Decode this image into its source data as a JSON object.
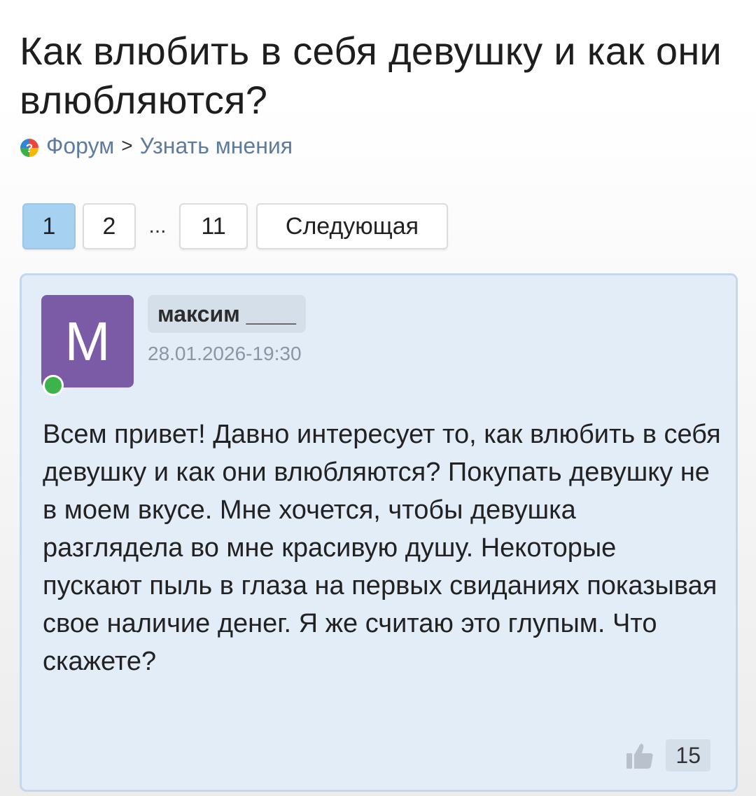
{
  "topic": {
    "title": "Как влюбить в себя девушку и как они влюбляются?"
  },
  "breadcrumb": {
    "icon": "forum-question-icon",
    "forum": "Форум",
    "separator": ">",
    "section": "Узнать мнения"
  },
  "pagination": {
    "pages": [
      "1",
      "2",
      "11"
    ],
    "current": "1",
    "ellipsis": "...",
    "next_label": "Следующая"
  },
  "post": {
    "avatar_letter": "М",
    "avatar_color": "#7b5aa6",
    "online": true,
    "online_color": "#3cb44b",
    "author": "максим ____",
    "datetime": "28.01.2026-19:30",
    "text": "Всем привет! Давно интересует то, как влюбить в себя девушку и как они влюбляются? Покупать девушку не в моем вкусе. Мне хочется, чтобы девушка разглядела во мне красивую душу. Некоторые пускают пыль в глаза на первых свиданиях показывая свое наличие денег. Я же считаю это глупым. Что скажете?",
    "like_icon": "thumbs-up-icon",
    "likes": "15"
  },
  "colors": {
    "accent_page": "#a7d1f0",
    "post_bg": "#e3edf8",
    "link": "#5e7a9c"
  }
}
